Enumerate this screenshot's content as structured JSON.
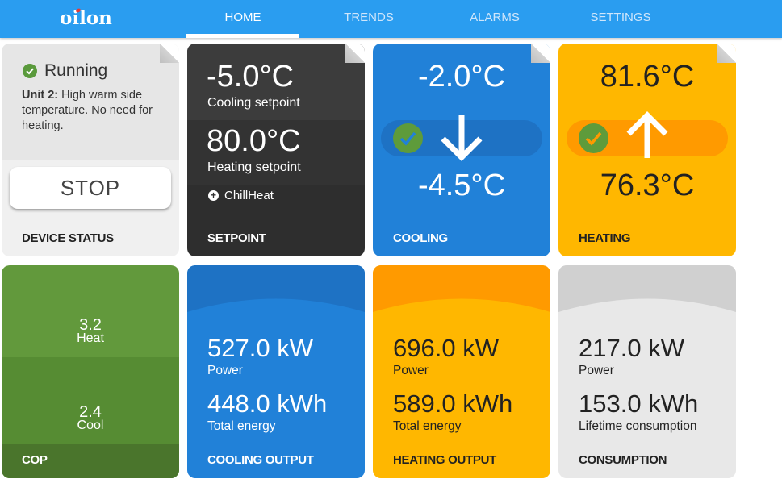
{
  "header": {
    "logo_text": "oilon",
    "tabs": [
      {
        "label": "HOME",
        "active": true
      },
      {
        "label": "TRENDS",
        "active": false
      },
      {
        "label": "ALARMS",
        "active": false
      },
      {
        "label": "SETTINGS",
        "active": false
      }
    ]
  },
  "colors": {
    "header": "#2a9df0",
    "cooling": "#2181d8",
    "heating": "#ffb700",
    "cop": "#62993c",
    "setpoint": "#2e2e2e",
    "status_ok": "#5a9a3c"
  },
  "device_status": {
    "state": "Running",
    "state_icon": "check-circle-icon",
    "message_unit": "Unit 2:",
    "message_text": " High warm side temperature. No need for heating.",
    "stop_label": "STOP",
    "title": "DEVICE STATUS"
  },
  "setpoint": {
    "cooling_value": "-5.0°C",
    "cooling_label": "Cooling setpoint",
    "heating_value": "80.0°C",
    "heating_label": "Heating setpoint",
    "mode_icon": "plus-circle-icon",
    "mode_label": "ChillHeat",
    "title": "SETPOINT"
  },
  "cooling": {
    "inlet_temp": "-2.0°C",
    "outlet_temp": "-4.5°C",
    "direction_icon": "arrow-down-icon",
    "status_icon": "check-circle-icon",
    "title": "COOLING"
  },
  "heating": {
    "outlet_temp": "81.6°C",
    "inlet_temp": "76.3°C",
    "direction_icon": "arrow-up-icon",
    "status_icon": "check-circle-icon",
    "title": "HEATING"
  },
  "cop": {
    "heat": {
      "value": "3.2",
      "label": "Heat",
      "gauge_fraction": 0.66
    },
    "cool": {
      "value": "2.4",
      "label": "Cool",
      "gauge_fraction": 0.5
    },
    "title": "COP"
  },
  "cooling_output": {
    "power_value": "527.0 kW",
    "power_label": "Power",
    "energy_value": "448.0 kWh",
    "energy_label": "Total energy",
    "gauge_fraction": 0.5,
    "title": "COOLING OUTPUT"
  },
  "heating_output": {
    "power_value": "696.0 kW",
    "power_label": "Power",
    "energy_value": "589.0 kWh",
    "energy_label": "Total energy",
    "gauge_fraction": 0.72,
    "title": "HEATING OUTPUT"
  },
  "consumption": {
    "power_value": "217.0 kW",
    "power_label": "Power",
    "energy_value": "153.0 kWh",
    "energy_label": "Lifetime consumption",
    "gauge_fraction": 0.22,
    "title": "CONSUMPTION"
  }
}
